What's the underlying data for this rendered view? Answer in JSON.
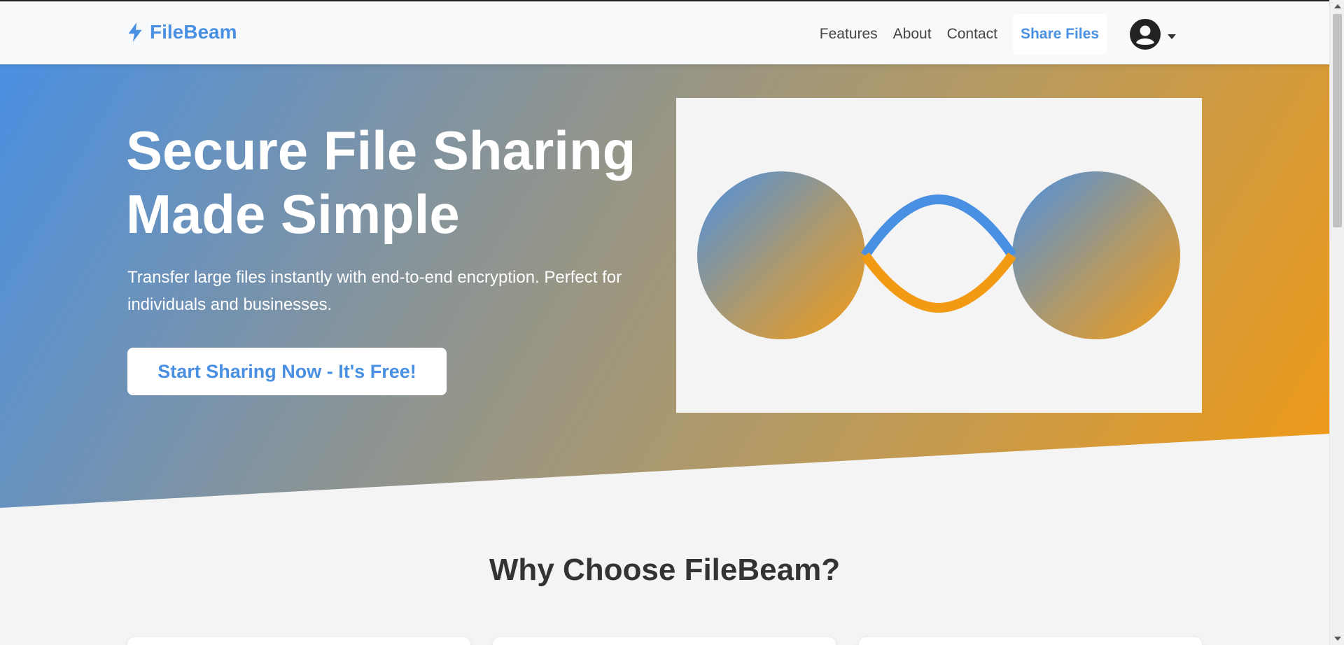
{
  "nav": {
    "brand": "FileBeam",
    "links": [
      "Features",
      "About",
      "Contact"
    ],
    "share_label": "Share Files"
  },
  "hero": {
    "title_line1": "Secure File Sharing",
    "title_line2": "Made Simple",
    "subtitle": "Transfer large files instantly with end-to-end encryption. Perfect for individuals and businesses.",
    "cta_label": "Start Sharing Now - It's Free!"
  },
  "features": {
    "title": "Why Choose FileBeam?"
  },
  "colors": {
    "brand_blue": "#4a90e2",
    "brand_orange": "#f29a14",
    "page_bg": "#f4f4f4"
  }
}
